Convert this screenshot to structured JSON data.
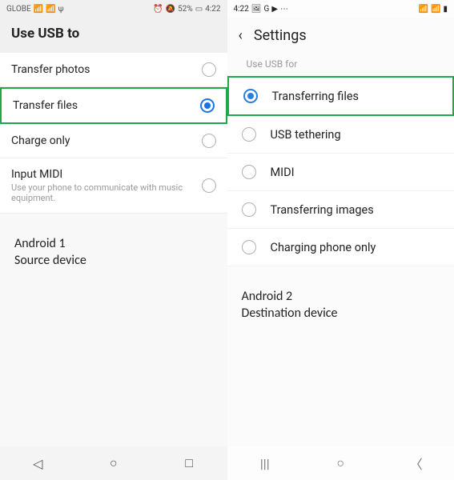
{
  "left": {
    "statusbar": {
      "carrier": "GLOBE",
      "signal": "📶",
      "wifi": "📶",
      "usb": "ψ",
      "alarm": "⏰",
      "dnd": "🔕",
      "battery_pct": "52%",
      "battery_icon": "▭",
      "time": "4:22"
    },
    "title": "Use USB to",
    "options": [
      {
        "label": "Transfer photos",
        "sub": "",
        "selected": false,
        "highlight": false
      },
      {
        "label": "Transfer files",
        "sub": "",
        "selected": true,
        "highlight": true
      },
      {
        "label": "Charge only",
        "sub": "",
        "selected": false,
        "highlight": false
      },
      {
        "label": "Input MIDI",
        "sub": "Use your phone to communicate with music equipment.",
        "selected": false,
        "highlight": false
      }
    ],
    "caption_l1": "Android 1",
    "caption_l2": "Source device",
    "nav": {
      "back": "◁",
      "home": "○",
      "recent": "□"
    }
  },
  "right": {
    "statusbar": {
      "time": "4:22",
      "i_img": "🖼",
      "i_g": "G",
      "i_yt": "▶",
      "i_more": "⋯",
      "signal1": "📶",
      "signal2": "📶",
      "battery": "▮"
    },
    "header_title": "Settings",
    "subhead": "Use USB for",
    "options": [
      {
        "label": "Transferring files",
        "selected": true,
        "highlight": true
      },
      {
        "label": "USB tethering",
        "selected": false,
        "highlight": false
      },
      {
        "label": "MIDI",
        "selected": false,
        "highlight": false
      },
      {
        "label": "Transferring images",
        "selected": false,
        "highlight": false
      },
      {
        "label": "Charging phone only",
        "selected": false,
        "highlight": false
      }
    ],
    "caption_l1": "Android 2",
    "caption_l2": "Destination device",
    "nav": {
      "recent": "|||",
      "home": "○",
      "back": "〈"
    }
  }
}
